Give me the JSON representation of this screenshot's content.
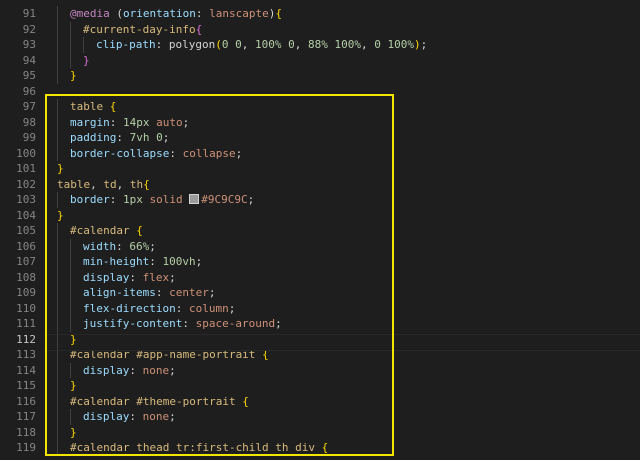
{
  "editor": {
    "current_line": "112",
    "lines": [
      {
        "n": "91",
        "indent": 1,
        "tokens": [
          [
            "kw",
            "@media"
          ],
          [
            "punc",
            " ("
          ],
          [
            "prop",
            "orientation"
          ],
          [
            "punc",
            ": "
          ],
          [
            "val",
            "lanscapte"
          ],
          [
            "punc",
            ")"
          ],
          [
            "brace",
            "{"
          ]
        ]
      },
      {
        "n": "92",
        "indent": 2,
        "tokens": [
          [
            "sel",
            "#current-day-info"
          ],
          [
            "brace2",
            "{"
          ]
        ]
      },
      {
        "n": "93",
        "indent": 3,
        "tokens": [
          [
            "prop",
            "clip-path"
          ],
          [
            "punc",
            ": "
          ],
          [
            "punc",
            "polygon"
          ],
          [
            "brace",
            "("
          ],
          [
            "num",
            "0 0"
          ],
          [
            "punc",
            ", "
          ],
          [
            "num",
            "100% 0"
          ],
          [
            "punc",
            ", "
          ],
          [
            "num",
            "88% 100%"
          ],
          [
            "punc",
            ", "
          ],
          [
            "num",
            "0 100%"
          ],
          [
            "brace",
            ")"
          ],
          [
            "punc",
            ";"
          ]
        ]
      },
      {
        "n": "94",
        "indent": 2,
        "tokens": [
          [
            "brace2",
            "}"
          ]
        ]
      },
      {
        "n": "95",
        "indent": 1,
        "tokens": [
          [
            "brace",
            "}"
          ]
        ]
      },
      {
        "n": "96",
        "indent": 0,
        "tokens": []
      },
      {
        "n": "97",
        "indent": 1,
        "tokens": [
          [
            "sel",
            "table"
          ],
          [
            "punc",
            " "
          ],
          [
            "brace",
            "{"
          ]
        ]
      },
      {
        "n": "98",
        "indent": 1,
        "tokens": [
          [
            "prop",
            "margin"
          ],
          [
            "punc",
            ": "
          ],
          [
            "num",
            "14px"
          ],
          [
            "punc",
            " "
          ],
          [
            "val",
            "auto"
          ],
          [
            "punc",
            ";"
          ]
        ]
      },
      {
        "n": "99",
        "indent": 1,
        "tokens": [
          [
            "prop",
            "padding"
          ],
          [
            "punc",
            ": "
          ],
          [
            "num",
            "7vh 0"
          ],
          [
            "punc",
            ";"
          ]
        ]
      },
      {
        "n": "100",
        "indent": 1,
        "tokens": [
          [
            "prop",
            "border-collapse"
          ],
          [
            "punc",
            ": "
          ],
          [
            "val",
            "collapse"
          ],
          [
            "punc",
            ";"
          ]
        ]
      },
      {
        "n": "101",
        "indent": 0,
        "tokens": [
          [
            "brace",
            "}"
          ]
        ]
      },
      {
        "n": "102",
        "indent": 0,
        "tokens": [
          [
            "sel",
            "table"
          ],
          [
            "punc",
            ", "
          ],
          [
            "sel",
            "td"
          ],
          [
            "punc",
            ", "
          ],
          [
            "sel",
            "th"
          ],
          [
            "brace",
            "{"
          ]
        ]
      },
      {
        "n": "103",
        "indent": 1,
        "tokens": [
          [
            "prop",
            "border"
          ],
          [
            "punc",
            ": "
          ],
          [
            "num",
            "1px"
          ],
          [
            "punc",
            " "
          ],
          [
            "val",
            "solid"
          ],
          [
            "punc",
            " "
          ],
          [
            "swatch",
            "#9C9C9C"
          ],
          [
            "val",
            "#9C9C9C"
          ],
          [
            "punc",
            ";"
          ]
        ]
      },
      {
        "n": "104",
        "indent": 0,
        "tokens": [
          [
            "brace",
            "}"
          ]
        ]
      },
      {
        "n": "105",
        "indent": 1,
        "tokens": [
          [
            "sel",
            "#calendar"
          ],
          [
            "punc",
            " "
          ],
          [
            "brace",
            "{"
          ]
        ]
      },
      {
        "n": "106",
        "indent": 2,
        "tokens": [
          [
            "prop",
            "width"
          ],
          [
            "punc",
            ": "
          ],
          [
            "num",
            "66%"
          ],
          [
            "punc",
            ";"
          ]
        ]
      },
      {
        "n": "107",
        "indent": 2,
        "tokens": [
          [
            "prop",
            "min-height"
          ],
          [
            "punc",
            ": "
          ],
          [
            "num",
            "100vh"
          ],
          [
            "punc",
            ";"
          ]
        ]
      },
      {
        "n": "108",
        "indent": 2,
        "tokens": [
          [
            "prop",
            "display"
          ],
          [
            "punc",
            ": "
          ],
          [
            "val",
            "flex"
          ],
          [
            "punc",
            ";"
          ]
        ]
      },
      {
        "n": "109",
        "indent": 2,
        "tokens": [
          [
            "prop",
            "align-items"
          ],
          [
            "punc",
            ": "
          ],
          [
            "val",
            "center"
          ],
          [
            "punc",
            ";"
          ]
        ]
      },
      {
        "n": "110",
        "indent": 2,
        "tokens": [
          [
            "prop",
            "flex-direction"
          ],
          [
            "punc",
            ": "
          ],
          [
            "val",
            "column"
          ],
          [
            "punc",
            ";"
          ]
        ]
      },
      {
        "n": "111",
        "indent": 2,
        "tokens": [
          [
            "prop",
            "justify-content"
          ],
          [
            "punc",
            ": "
          ],
          [
            "val",
            "space-around"
          ],
          [
            "punc",
            ";"
          ]
        ]
      },
      {
        "n": "112",
        "indent": 1,
        "tokens": [
          [
            "brace",
            "}"
          ]
        ]
      },
      {
        "n": "113",
        "indent": 1,
        "tokens": [
          [
            "sel",
            "#calendar #app-name-portrait"
          ],
          [
            "punc",
            " "
          ],
          [
            "brace",
            "{"
          ]
        ]
      },
      {
        "n": "114",
        "indent": 2,
        "tokens": [
          [
            "prop",
            "display"
          ],
          [
            "punc",
            ": "
          ],
          [
            "val",
            "none"
          ],
          [
            "punc",
            ";"
          ]
        ]
      },
      {
        "n": "115",
        "indent": 1,
        "tokens": [
          [
            "brace",
            "}"
          ]
        ]
      },
      {
        "n": "116",
        "indent": 1,
        "tokens": [
          [
            "sel",
            "#calendar #theme-portrait"
          ],
          [
            "punc",
            " "
          ],
          [
            "brace",
            "{"
          ]
        ]
      },
      {
        "n": "117",
        "indent": 2,
        "tokens": [
          [
            "prop",
            "display"
          ],
          [
            "punc",
            ": "
          ],
          [
            "val",
            "none"
          ],
          [
            "punc",
            ";"
          ]
        ]
      },
      {
        "n": "118",
        "indent": 1,
        "tokens": [
          [
            "brace",
            "}"
          ]
        ]
      },
      {
        "n": "119",
        "indent": 1,
        "tokens": [
          [
            "sel",
            "#calendar thead tr:first-child th div"
          ],
          [
            "punc",
            " "
          ],
          [
            "brace",
            "{"
          ]
        ]
      }
    ]
  },
  "colors": {
    "highlight_box": "#f2e600",
    "background": "#1e1e1e"
  }
}
